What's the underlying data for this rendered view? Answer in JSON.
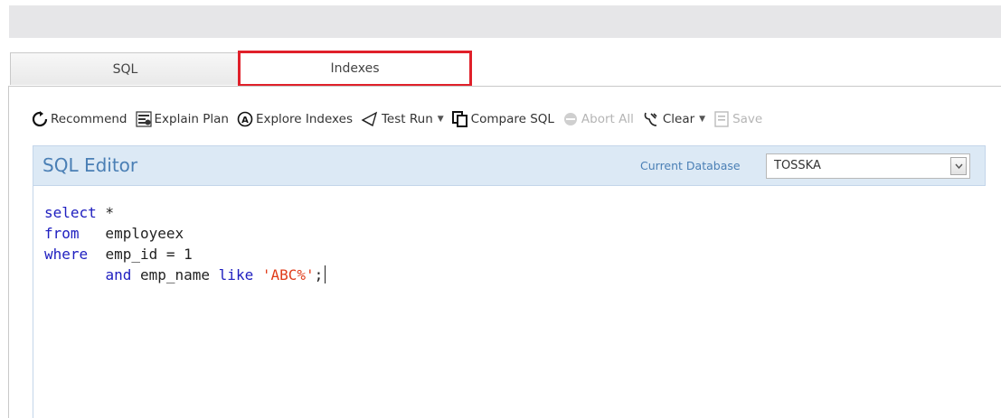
{
  "tabs": [
    {
      "label": "SQL",
      "active": false
    },
    {
      "label": "Indexes",
      "active": true
    }
  ],
  "toolbar": {
    "recommend": "Recommend",
    "explain_plan": "Explain Plan",
    "explore_indexes": "Explore Indexes",
    "test_run": "Test Run",
    "compare_sql": "Compare SQL",
    "abort_all": "Abort All",
    "clear": "Clear",
    "save": "Save"
  },
  "editor": {
    "title": "SQL Editor",
    "current_database_label": "Current Database",
    "current_database_value": "TOSSKA",
    "code": {
      "l1_kw": "select",
      "l1_rest": " *",
      "l2_kw": "from",
      "l2_rest": "   employeex",
      "l3_kw": "where",
      "l3_rest": "  emp_id = 1",
      "l4_indent": "       ",
      "l4_kw1": "and",
      "l4_mid": " emp_name ",
      "l4_kw2": "like",
      "l4_sp": " ",
      "l4_str": "'ABC%'",
      "l4_end": ";"
    }
  },
  "colors": {
    "highlight_border": "#e0202a",
    "editor_header_bg": "#dce9f5",
    "editor_title": "#4a7fb5",
    "keyword": "#2020c0",
    "string": "#e03c1a"
  }
}
